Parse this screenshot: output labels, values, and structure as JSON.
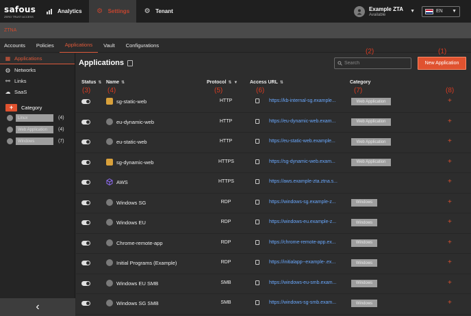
{
  "topbar": {
    "brand": "safous",
    "brand_sub": "ZERO TRUST ACCESS",
    "nav": [
      {
        "label": "Analytics",
        "icon": "analytics-icon"
      },
      {
        "label": "Settings",
        "icon": "gear-icon"
      },
      {
        "label": "Tenant",
        "icon": "tenant-icon"
      }
    ],
    "user": {
      "name": "Example ZTA",
      "status": "Available"
    },
    "language": "EN"
  },
  "breadcrumb": "ZTNA",
  "subtabs": [
    "Accounts",
    "Policies",
    "Applications",
    "Vault",
    "Configurations"
  ],
  "sidebar": {
    "items": [
      {
        "label": "Applications",
        "icon": "applications-icon"
      },
      {
        "label": "Networks",
        "icon": "globe-icon"
      },
      {
        "label": "Links",
        "icon": "link-icon"
      },
      {
        "label": "SaaS",
        "icon": "cloud-icon"
      }
    ],
    "category_label": "Category",
    "categories": [
      {
        "label": "Linux",
        "count": "(4)"
      },
      {
        "label": "Web Application",
        "count": "(4)"
      },
      {
        "label": "Windows",
        "count": "(7)"
      }
    ]
  },
  "main": {
    "title": "Applications",
    "search_placeholder": "Search",
    "new_button": "New Application",
    "columns": {
      "status": "Status",
      "name": "Name",
      "protocol": "Protocol",
      "access_url": "Access URL",
      "category": "Category"
    },
    "annotations": [
      "(1)",
      "(2)",
      "(3)",
      "(4)",
      "(5)",
      "(6)",
      "(7)",
      "(8)"
    ],
    "rows": [
      {
        "name": "sg-static-web",
        "protocol": "HTTP",
        "url": "https://kb-internal-sg.example...",
        "category": "Web Application",
        "icon": "k8s"
      },
      {
        "name": "eu-dynamic-web",
        "protocol": "HTTP",
        "url": "https://eu-dynamic-web.exam...",
        "category": "Web Application",
        "icon": "generic"
      },
      {
        "name": "eu-static-web",
        "protocol": "HTTP",
        "url": "https://eu-static-web.example...",
        "category": "Web Application",
        "icon": "generic"
      },
      {
        "name": "sg-dynamic-web",
        "protocol": "HTTPS",
        "url": "https://sg-dynamic-web.exam...",
        "category": "Web Application",
        "icon": "k8s"
      },
      {
        "name": "AWS",
        "protocol": "HTTPS",
        "url": "https://aws.example-zta.ztna.s...",
        "category": "",
        "icon": "aws"
      },
      {
        "name": "Windows SG",
        "protocol": "RDP",
        "url": "https://windows-sg.example-z...",
        "category": "Windows",
        "icon": "generic"
      },
      {
        "name": "Windows EU",
        "protocol": "RDP",
        "url": "https://windows-eu.example-z...",
        "category": "Windows",
        "icon": "generic"
      },
      {
        "name": "Chrome-remote-app",
        "protocol": "RDP",
        "url": "https://chrome-remote-app.ex...",
        "category": "Windows",
        "icon": "generic"
      },
      {
        "name": "Initial Programs (Example)",
        "protocol": "RDP",
        "url": "https://initialapp--example-.ex...",
        "category": "Windows",
        "icon": "generic"
      },
      {
        "name": "Windows EU SMB",
        "protocol": "SMB",
        "url": "https://windows-eu-smb.exam...",
        "category": "Windows",
        "icon": "generic"
      },
      {
        "name": "Windows SG SMB",
        "protocol": "SMB",
        "url": "https://windows-sg-smb.exam...",
        "category": "Windows",
        "icon": "generic"
      }
    ]
  },
  "colors": {
    "accent": "#e0522f",
    "link": "#6aa9ff",
    "annotation": "#d83c22"
  }
}
